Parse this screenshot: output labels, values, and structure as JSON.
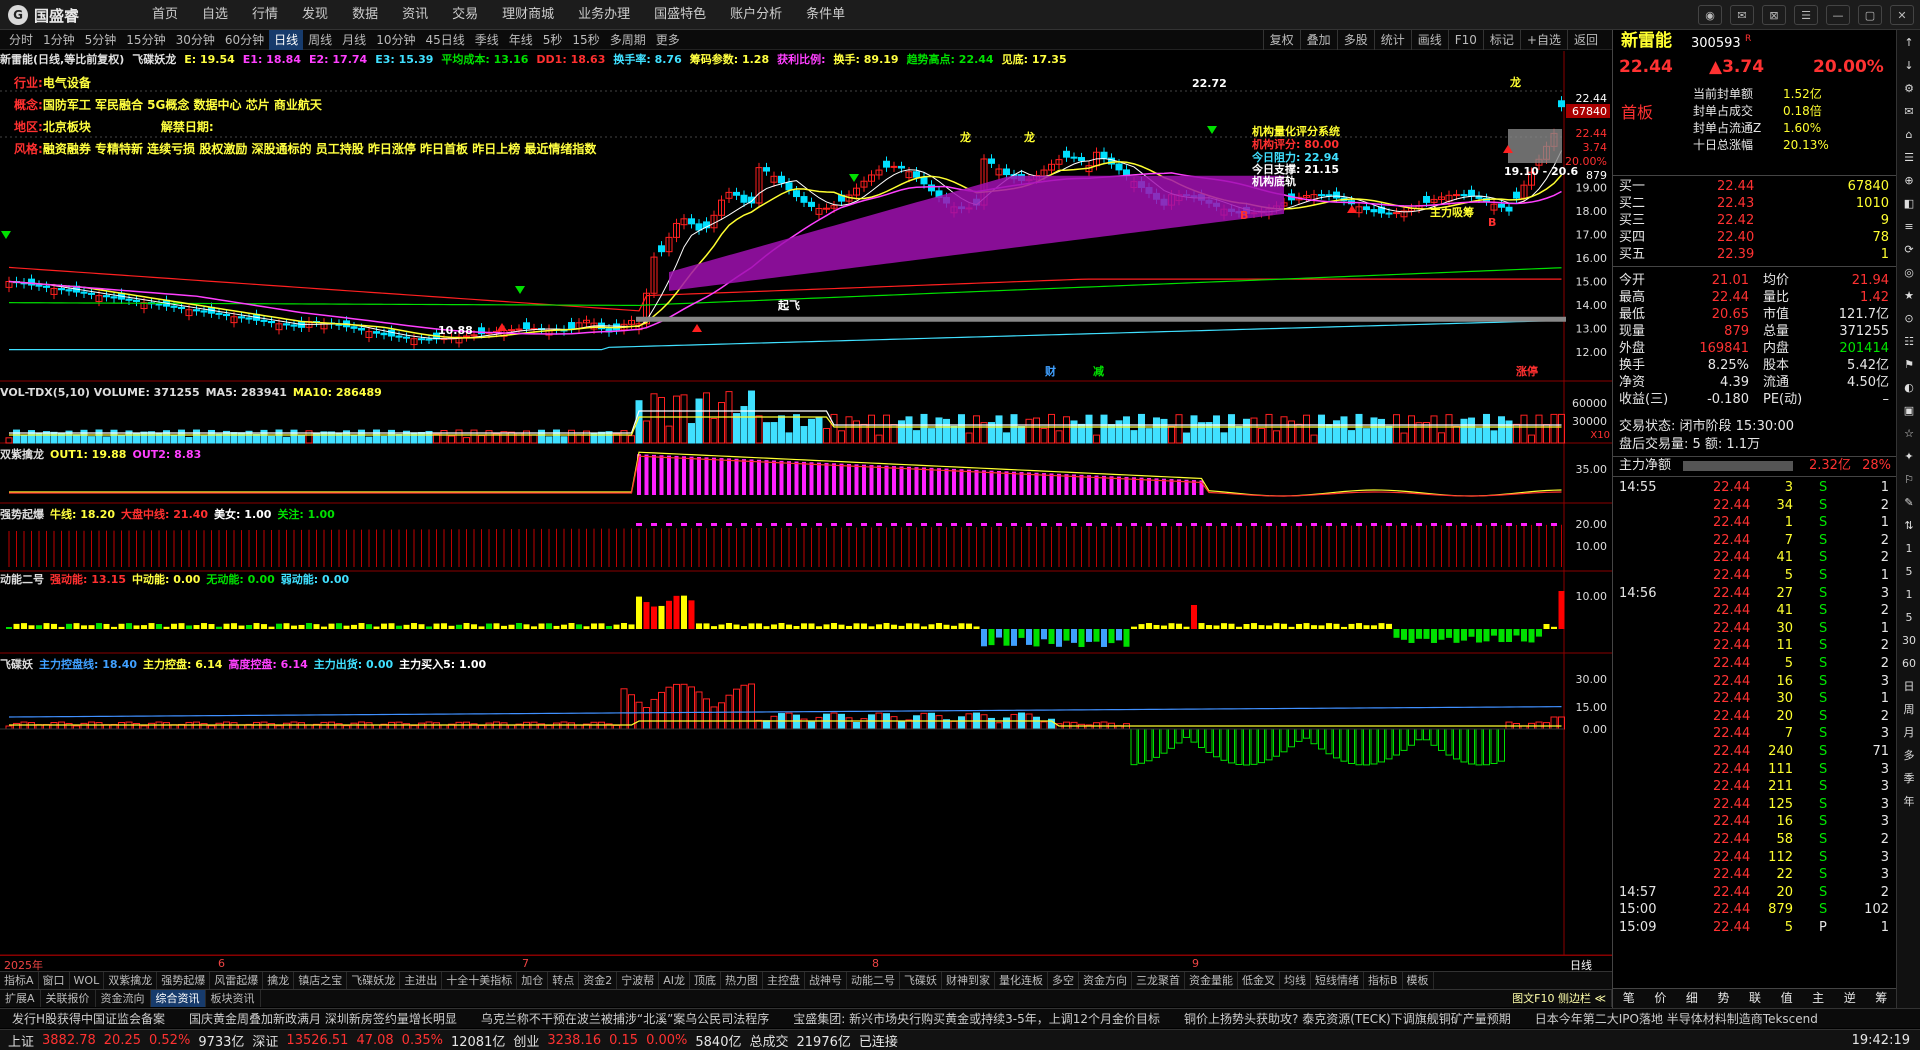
{
  "app": {
    "brand": "国盛睿",
    "menu": [
      "首页",
      "自选",
      "行情",
      "发现",
      "数据",
      "资讯",
      "交易",
      "理财商城",
      "业务办理",
      "国盛特色",
      "账户分析",
      "条件单"
    ]
  },
  "toolbar": {
    "periods": [
      "分时",
      "1分钟",
      "5分钟",
      "15分钟",
      "30分钟",
      "60分钟",
      "日线",
      "周线",
      "月线",
      "10分钟",
      "45日线",
      "季线",
      "年线",
      "5秒",
      "15秒",
      "多周期",
      "更多"
    ],
    "active_period": "日线",
    "tools": [
      "复权",
      "叠加",
      "多股",
      "统计",
      "画线",
      "F10",
      "标记",
      "+自选",
      "返回"
    ]
  },
  "legend": {
    "items": [
      {
        "t": "新雷能(日线,等比前复权)",
        "c": "#e0e0e0"
      },
      {
        "t": "飞碟妖龙",
        "c": "#e0e0e0"
      },
      {
        "t": "E: 19.54",
        "c": "#ffff40"
      },
      {
        "t": "E1: 18.84",
        "c": "#ff40ff"
      },
      {
        "t": "E2: 17.74",
        "c": "#ff40ff"
      },
      {
        "t": "E3: 15.39",
        "c": "#40e0ff"
      },
      {
        "t": "平均成本: 13.16",
        "c": "#00e000"
      },
      {
        "t": "DD1: 18.63",
        "c": "#ff3030"
      },
      {
        "t": "换手率: 8.76",
        "c": "#40e0ff"
      },
      {
        "t": "筹码参数: 1.28",
        "c": "#ffff40"
      },
      {
        "t": "获利比例:",
        "c": "#ff40ff"
      },
      {
        "t": "换手: 89.19",
        "c": "#ffff40"
      },
      {
        "t": "趋势高点: 22.44",
        "c": "#00e000"
      },
      {
        "t": "见底: 17.35",
        "c": "#ffff40"
      }
    ]
  },
  "info": {
    "industry_label": "行业:",
    "industry": "电气设备",
    "concept_label": "概念:",
    "concept": "国防军工 军民融合 5G概念 数据中心 芯片 商业航天",
    "region_label": "地区:",
    "region": "北京板块",
    "unlock_label": "解禁日期:",
    "style_label": "风格:",
    "style": "融资融券 专精特新 连续亏损 股权激励 深股通标的 员工持股 昨日涨停 昨日首板 昨日上榜 最近情绪指数"
  },
  "annotations": {
    "peak": "22.72",
    "low": "10.88",
    "system_title": "机构量化评分系统",
    "score": "机构评分: 80.00",
    "resist": "今日阻力: 22.94",
    "support": "今日支撑: 21.15",
    "plan": "机构底轨",
    "range": "19.10 - 20.6",
    "zlx": "主力吸筹",
    "fin": "财",
    "cut": "减",
    "up": "涨停",
    "bot": "见底B",
    "ss": "起飞",
    "dragon": "龙"
  },
  "price_axis": [
    "22.44",
    "3.74",
    "20.00%",
    "879",
    "19.00",
    "18.00",
    "17.00",
    "16.00",
    "15.00",
    "14.00",
    "13.00",
    "12.00"
  ],
  "price_top": "22.44",
  "vol_top": "67840",
  "vol_panel": {
    "title": "VOL-TDX(5,10) VOLUME: 371255",
    "ma5": "MA5: 283941",
    "ma10": "MA10: 286489",
    "axis": [
      "60000",
      "30000",
      "X10"
    ]
  },
  "sz_panel": {
    "title": "双紫擒龙",
    "out1": "OUT1: 19.88",
    "out2": "OUT2: 8.83",
    "axis": [
      "35.00"
    ]
  },
  "qs_panel": {
    "title": "强势起爆",
    "a": "牛线: 18.20",
    "b": "大盘中线: 21.40",
    "c": "美女: 1.00",
    "d": "关注: 1.00",
    "axis": [
      "20.00",
      "10.00"
    ]
  },
  "dn_panel": {
    "title": "动能二号",
    "a": "强动能: 13.15",
    "b": "中动能: 0.00",
    "c": "无动能: 0.00",
    "d": "弱动能: 0.00",
    "axis": [
      "10.00"
    ]
  },
  "fd_panel": {
    "title": "飞碟妖",
    "a": "主力控盘线: 18.40",
    "b": "主力控盘: 6.14",
    "c": "高度控盘: 6.14",
    "d": "主力出货: 0.00",
    "e": "主力买入5: 1.00",
    "axis": [
      "30.00",
      "15.00",
      "0.00"
    ]
  },
  "xaxis": {
    "labels": [
      "2025年",
      "6",
      "7",
      "8",
      "9"
    ],
    "right": "日线"
  },
  "tabs": [
    "指标A",
    "窗口",
    "WOL",
    "双紫擒龙",
    "强势起爆",
    "风雷起爆",
    "擒龙",
    "镇店之宝",
    "飞碟妖龙",
    "主进出",
    "十全十美指标",
    "加仓",
    "转点",
    "资金2",
    "宁波帮",
    "AI龙",
    "顶底",
    "热力图",
    "主控盘",
    "战神号",
    "动能二号",
    "飞碟妖",
    "财神到家",
    "量化连板",
    "多空",
    "资金方向",
    "三龙聚首",
    "资金量能",
    "低金叉",
    "均线",
    "短线情绪",
    "指标B",
    "模板"
  ],
  "tabs2": [
    "扩展A",
    "关联报价",
    "资金流向",
    "综合资讯",
    "板块资讯"
  ],
  "tabs2_active": "综合资讯",
  "tabs2_right": "图文F10 侧边栏 ≪",
  "news": [
    "发行H股获得中国证监会备案",
    "国庆黄金周叠加新政满月 深圳新房签约量增长明显",
    "乌克兰称不干预在波兰被捕涉“北溪”案乌公民司法程序",
    "宝盛集团: 新兴市场央行购买黄金或持续3-5年，上调12个月金价目标",
    "铜价上扬势头获助攻? 泰克资源(TECK)下调旗舰铜矿产量预期",
    "日本今年第二大IPO落地 半导体材料制造商Tekscend"
  ],
  "statusbar": {
    "sh_label": "上证",
    "sh": "3882.78",
    "sh_chg": "20.25",
    "sh_pct": "0.52%",
    "sh_amt": "9733亿",
    "sz_label": "深证",
    "sz": "13526.51",
    "sz_chg": "47.08",
    "sz_pct": "0.35%",
    "sz_amt": "12081亿",
    "cy_label": "创业",
    "cy": "3238.16",
    "cy_chg": "0.15",
    "cy_pct": "0.00%",
    "cy_amt": "5840亿",
    "total_label": "总成交",
    "total": "21976亿",
    "conn": "已连接",
    "time": "19:42:19"
  },
  "quote": {
    "name": "新雷能",
    "code": "300593",
    "code_tag": "R",
    "price": "22.44",
    "change": "▲3.74",
    "pct": "20.00%",
    "tag": "首板",
    "limit": [
      [
        "当前封单额",
        "1.52亿"
      ],
      [
        "封单占成交",
        "0.18倍"
      ],
      [
        "封单占流通Z",
        "1.60%"
      ],
      [
        "十日总涨幅",
        "20.13%"
      ]
    ],
    "bids": [
      [
        "买一",
        "22.44",
        "67840"
      ],
      [
        "买二",
        "22.43",
        "1010"
      ],
      [
        "买三",
        "22.42",
        "9"
      ],
      [
        "买四",
        "22.40",
        "78"
      ],
      [
        "买五",
        "22.39",
        "1"
      ]
    ],
    "stats": [
      [
        "今开",
        "21.01",
        "均价",
        "21.94"
      ],
      [
        "最高",
        "22.44",
        "量比",
        "1.42"
      ],
      [
        "最低",
        "20.65",
        "市值",
        "121.7亿"
      ],
      [
        "现量",
        "879",
        "总量",
        "371255"
      ],
      [
        "外盘",
        "169841",
        "内盘",
        "201414"
      ],
      [
        "换手",
        "8.25%",
        "股本",
        "5.42亿"
      ],
      [
        "净资",
        "4.39",
        "流通",
        "4.50亿"
      ],
      [
        "收益(三)",
        "-0.180",
        "PE(动)",
        "–"
      ]
    ],
    "trade_state": "交易状态: 闭市阶段 15:30:00",
    "after": "盘后交易量: 5  额: 1.1万",
    "flow_label": "主力净额",
    "flow": "2.32亿",
    "flow_pct": "28%",
    "ticks": [
      [
        "14:55",
        "22.44",
        "3",
        "S",
        "1"
      ],
      [
        "",
        "22.44",
        "34",
        "S",
        "2"
      ],
      [
        "",
        "22.44",
        "1",
        "S",
        "1"
      ],
      [
        "",
        "22.44",
        "7",
        "S",
        "2"
      ],
      [
        "",
        "22.44",
        "41",
        "S",
        "2"
      ],
      [
        "",
        "22.44",
        "5",
        "S",
        "1"
      ],
      [
        "14:56",
        "22.44",
        "27",
        "S",
        "3"
      ],
      [
        "",
        "22.44",
        "41",
        "S",
        "2"
      ],
      [
        "",
        "22.44",
        "30",
        "S",
        "1"
      ],
      [
        "",
        "22.44",
        "11",
        "S",
        "2"
      ],
      [
        "",
        "22.44",
        "5",
        "S",
        "2"
      ],
      [
        "",
        "22.44",
        "16",
        "S",
        "3"
      ],
      [
        "",
        "22.44",
        "30",
        "S",
        "1"
      ],
      [
        "",
        "22.44",
        "20",
        "S",
        "2"
      ],
      [
        "",
        "22.44",
        "7",
        "S",
        "3"
      ],
      [
        "",
        "22.44",
        "240",
        "S",
        "71"
      ],
      [
        "",
        "22.44",
        "111",
        "S",
        "3"
      ],
      [
        "",
        "22.44",
        "211",
        "S",
        "3"
      ],
      [
        "",
        "22.44",
        "125",
        "S",
        "3"
      ],
      [
        "",
        "22.44",
        "16",
        "S",
        "3"
      ],
      [
        "",
        "22.44",
        "58",
        "S",
        "2"
      ],
      [
        "",
        "22.44",
        "112",
        "S",
        "3"
      ],
      [
        "",
        "22.44",
        "22",
        "S",
        "3"
      ],
      [
        "14:57",
        "22.44",
        "20",
        "S",
        "2"
      ],
      [
        "15:00",
        "22.44",
        "879",
        "S",
        "102"
      ],
      [
        "15:09",
        "22.44",
        "5",
        "P",
        "1"
      ]
    ],
    "bottom_tabs": [
      "笔",
      "价",
      "细",
      "势",
      "联",
      "值",
      "主",
      "逆",
      "筹"
    ]
  },
  "rail": [
    "↑",
    "↓",
    "⚙",
    "✉",
    "⌂",
    "☰",
    "⊕",
    "◧",
    "≡",
    "⟳",
    "◎",
    "★",
    "⊙",
    "☷",
    "⚑",
    "◐",
    "▣",
    "☆",
    "✦",
    "⚐",
    "✎",
    "⇅",
    "1",
    "5",
    "1",
    "5",
    "30",
    "60",
    "日",
    "周",
    "月",
    "多",
    "季",
    "年"
  ]
}
